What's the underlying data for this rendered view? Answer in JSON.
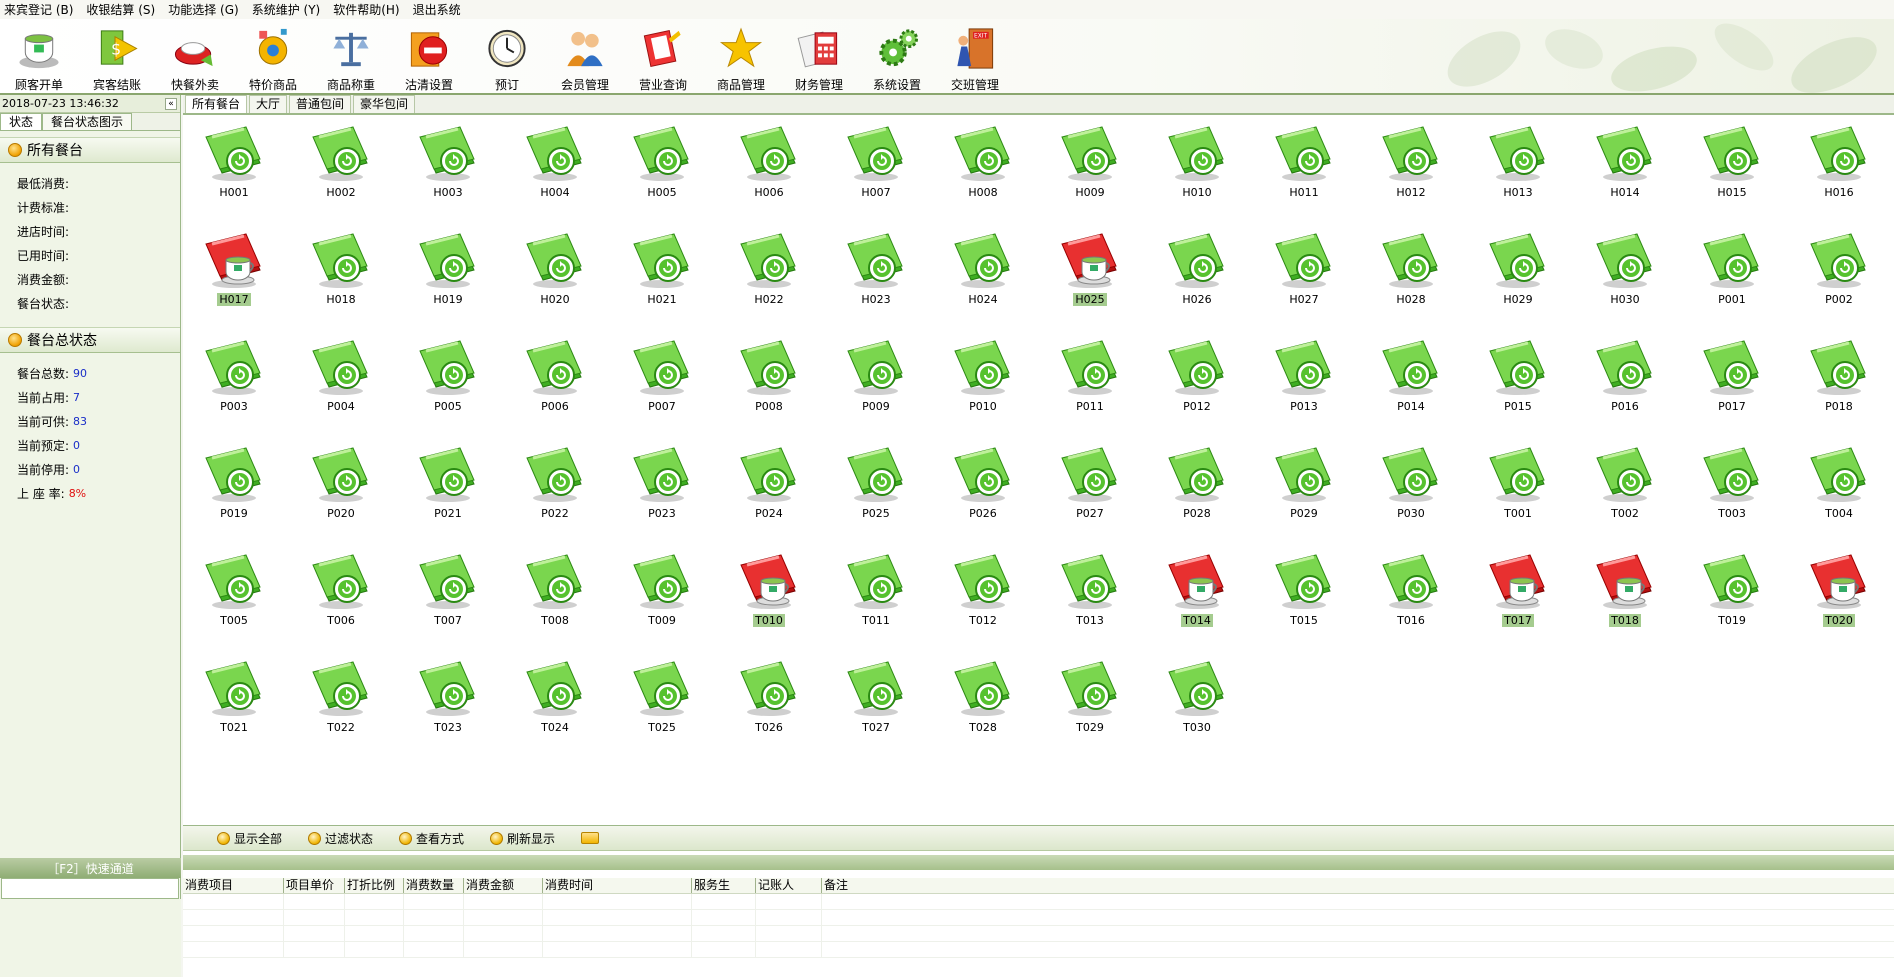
{
  "menu": [
    "来宾登记 (B)",
    "收银结算 (S)",
    "功能选择 (G)",
    "系统维护 (Y)",
    "软件帮助(H)",
    "退出系统"
  ],
  "toolbar": [
    {
      "label": "顾客开单",
      "icon": "teacup-icon"
    },
    {
      "label": "宾客结账",
      "icon": "checkout-arrow-icon"
    },
    {
      "label": "快餐外卖",
      "icon": "takeout-icon"
    },
    {
      "label": "特价商品",
      "icon": "special-gear-icon"
    },
    {
      "label": "商品称重",
      "icon": "scale-icon"
    },
    {
      "label": "沽清设置",
      "icon": "no-entry-icon"
    },
    {
      "label": "预订",
      "icon": "clock-icon"
    },
    {
      "label": "会员管理",
      "icon": "members-icon"
    },
    {
      "label": "营业查询",
      "icon": "query-book-icon"
    },
    {
      "label": "商品管理",
      "icon": "star-icon"
    },
    {
      "label": "财务管理",
      "icon": "calculator-icon"
    },
    {
      "label": "系统设置",
      "icon": "gears-icon"
    },
    {
      "label": "交班管理",
      "icon": "exit-door-icon"
    }
  ],
  "left_panel": {
    "datetime": "2018-07-23 13:46:32",
    "collapse_icon": "«",
    "tabs": [
      "状态",
      "餐台状态图示"
    ],
    "all_tables_header": "所有餐台",
    "table_info": [
      {
        "label": "最低消费:",
        "value": ""
      },
      {
        "label": "计费标准:",
        "value": ""
      },
      {
        "label": "进店时间:",
        "value": ""
      },
      {
        "label": "已用时间:",
        "value": ""
      },
      {
        "label": "消费金额:",
        "value": ""
      },
      {
        "label": "餐台状态:",
        "value": ""
      }
    ],
    "summary_header": "餐台总状态",
    "summary": [
      {
        "label": "餐台总数:",
        "value": "90",
        "color": "#1a2ec8"
      },
      {
        "label": "当前占用:",
        "value": "7",
        "color": "#1a2ec8"
      },
      {
        "label": "当前可供:",
        "value": "83",
        "color": "#1a2ec8"
      },
      {
        "label": "当前预定:",
        "value": "0",
        "color": "#1a2ec8"
      },
      {
        "label": "当前停用:",
        "value": "0",
        "color": "#1a2ec8"
      },
      {
        "label": "上 座 率:",
        "value": "8%",
        "color": "#e01010"
      }
    ],
    "quick_channel": "［F2］快速通道"
  },
  "area_tabs": [
    "所有餐台",
    "大厅",
    "普通包间",
    "豪华包间"
  ],
  "tables": [
    {
      "id": "H001",
      "status": "free"
    },
    {
      "id": "H002",
      "status": "free"
    },
    {
      "id": "H003",
      "status": "free"
    },
    {
      "id": "H004",
      "status": "free"
    },
    {
      "id": "H005",
      "status": "free"
    },
    {
      "id": "H006",
      "status": "free"
    },
    {
      "id": "H007",
      "status": "free"
    },
    {
      "id": "H008",
      "status": "free"
    },
    {
      "id": "H009",
      "status": "free"
    },
    {
      "id": "H010",
      "status": "free"
    },
    {
      "id": "H011",
      "status": "free"
    },
    {
      "id": "H012",
      "status": "free"
    },
    {
      "id": "H013",
      "status": "free"
    },
    {
      "id": "H014",
      "status": "free"
    },
    {
      "id": "H015",
      "status": "free"
    },
    {
      "id": "H016",
      "status": "free"
    },
    {
      "id": "H017",
      "status": "occupied"
    },
    {
      "id": "H018",
      "status": "free"
    },
    {
      "id": "H019",
      "status": "free"
    },
    {
      "id": "H020",
      "status": "free"
    },
    {
      "id": "H021",
      "status": "free"
    },
    {
      "id": "H022",
      "status": "free"
    },
    {
      "id": "H023",
      "status": "free"
    },
    {
      "id": "H024",
      "status": "free"
    },
    {
      "id": "H025",
      "status": "occupied"
    },
    {
      "id": "H026",
      "status": "free"
    },
    {
      "id": "H027",
      "status": "free"
    },
    {
      "id": "H028",
      "status": "free"
    },
    {
      "id": "H029",
      "status": "free"
    },
    {
      "id": "H030",
      "status": "free"
    },
    {
      "id": "P001",
      "status": "free"
    },
    {
      "id": "P002",
      "status": "free"
    },
    {
      "id": "P003",
      "status": "free"
    },
    {
      "id": "P004",
      "status": "free"
    },
    {
      "id": "P005",
      "status": "free"
    },
    {
      "id": "P006",
      "status": "free"
    },
    {
      "id": "P007",
      "status": "free"
    },
    {
      "id": "P008",
      "status": "free"
    },
    {
      "id": "P009",
      "status": "free"
    },
    {
      "id": "P010",
      "status": "free"
    },
    {
      "id": "P011",
      "status": "free"
    },
    {
      "id": "P012",
      "status": "free"
    },
    {
      "id": "P013",
      "status": "free"
    },
    {
      "id": "P014",
      "status": "free"
    },
    {
      "id": "P015",
      "status": "free"
    },
    {
      "id": "P016",
      "status": "free"
    },
    {
      "id": "P017",
      "status": "free"
    },
    {
      "id": "P018",
      "status": "free"
    },
    {
      "id": "P019",
      "status": "free"
    },
    {
      "id": "P020",
      "status": "free"
    },
    {
      "id": "P021",
      "status": "free"
    },
    {
      "id": "P022",
      "status": "free"
    },
    {
      "id": "P023",
      "status": "free"
    },
    {
      "id": "P024",
      "status": "free"
    },
    {
      "id": "P025",
      "status": "free"
    },
    {
      "id": "P026",
      "status": "free"
    },
    {
      "id": "P027",
      "status": "free"
    },
    {
      "id": "P028",
      "status": "free"
    },
    {
      "id": "P029",
      "status": "free"
    },
    {
      "id": "P030",
      "status": "free"
    },
    {
      "id": "T001",
      "status": "free"
    },
    {
      "id": "T002",
      "status": "free"
    },
    {
      "id": "T003",
      "status": "free"
    },
    {
      "id": "T004",
      "status": "free"
    },
    {
      "id": "T005",
      "status": "free"
    },
    {
      "id": "T006",
      "status": "free"
    },
    {
      "id": "T007",
      "status": "free"
    },
    {
      "id": "T008",
      "status": "free"
    },
    {
      "id": "T009",
      "status": "free"
    },
    {
      "id": "T010",
      "status": "occupied"
    },
    {
      "id": "T011",
      "status": "free"
    },
    {
      "id": "T012",
      "status": "free"
    },
    {
      "id": "T013",
      "status": "free"
    },
    {
      "id": "T014",
      "status": "occupied"
    },
    {
      "id": "T015",
      "status": "free"
    },
    {
      "id": "T016",
      "status": "free"
    },
    {
      "id": "T017",
      "status": "occupied"
    },
    {
      "id": "T018",
      "status": "occupied"
    },
    {
      "id": "T019",
      "status": "free"
    },
    {
      "id": "T020",
      "status": "occupied"
    },
    {
      "id": "T021",
      "status": "free"
    },
    {
      "id": "T022",
      "status": "free"
    },
    {
      "id": "T023",
      "status": "free"
    },
    {
      "id": "T024",
      "status": "free"
    },
    {
      "id": "T025",
      "status": "free"
    },
    {
      "id": "T026",
      "status": "free"
    },
    {
      "id": "T027",
      "status": "free"
    },
    {
      "id": "T028",
      "status": "free"
    },
    {
      "id": "T029",
      "status": "free"
    },
    {
      "id": "T030",
      "status": "free"
    }
  ],
  "colors": {
    "free": "#4fc236",
    "occupied": "#e02020",
    "occupied_label_bg": "#a5cc8f",
    "panel_border": "#9db889"
  },
  "actions": [
    {
      "label": "显示全部",
      "icon": "show-all-icon"
    },
    {
      "label": "过滤状态",
      "icon": "filter-icon"
    },
    {
      "label": "查看方式",
      "icon": "view-mode-icon"
    },
    {
      "label": "刷新显示",
      "icon": "refresh-icon"
    }
  ],
  "detail_columns": [
    "消费项目",
    "项目单价",
    "打折比例",
    "消费数量",
    "消费金额",
    "消费时间",
    "服务生",
    "记账人",
    "备注"
  ]
}
